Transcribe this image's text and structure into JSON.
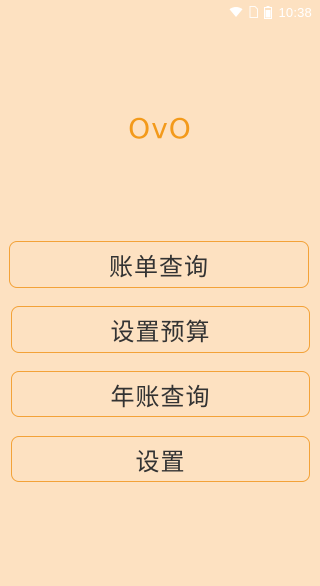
{
  "status_bar": {
    "time": "10:38",
    "icons": [
      "wifi-icon",
      "sim-icon",
      "battery-icon"
    ],
    "icon_color": "#FFFFFF"
  },
  "app": {
    "logo_text": "OvO",
    "background_color": "#FDE1C1",
    "accent_color": "#F39A1B",
    "button_border_color": "#F3A238"
  },
  "menu": {
    "items": [
      {
        "label": "账单查询"
      },
      {
        "label": "设置预算"
      },
      {
        "label": "年账查询"
      },
      {
        "label": "设置"
      }
    ]
  }
}
